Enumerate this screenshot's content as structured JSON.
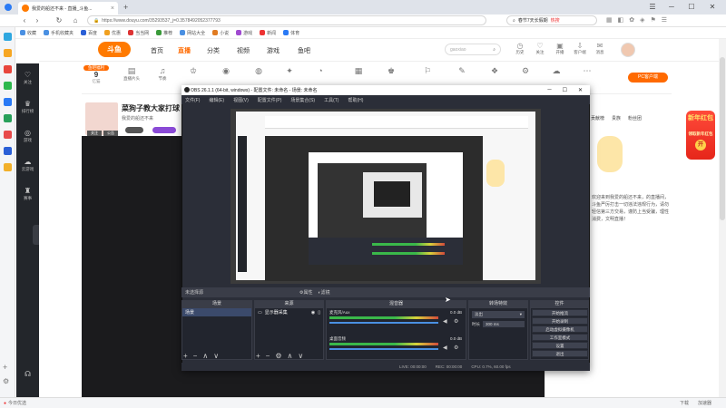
{
  "browser": {
    "tab_title": "我爱的船还不来 - 直播_斗鱼...",
    "url": "https://www.douyu.com/35293537_j=0.3578492052377793",
    "right_search": "春节7天长假期",
    "right_search_badge": "热搜"
  },
  "bookmarks": [
    "收藏",
    "手机收藏夹",
    "百度",
    "优惠",
    "当当网",
    "推荐",
    "网站大全",
    "小说",
    "游戏",
    "新闻",
    "体育",
    "公益",
    "网络",
    "视频"
  ],
  "header": {
    "logo": "斗鱼",
    "nav": [
      "首页",
      "直播",
      "分类",
      "视频",
      "游戏",
      "鱼吧"
    ],
    "search_placeholder": "gaoxiao",
    "right_icons": [
      {
        "label": "历史",
        "icon": "history-icon"
      },
      {
        "label": "关注",
        "icon": "follow-icon"
      },
      {
        "label": "开播",
        "icon": "broadcast-icon"
      },
      {
        "label": "客户端",
        "icon": "download-icon"
      },
      {
        "label": "消息",
        "icon": "message-icon"
      }
    ]
  },
  "room": {
    "rank_badge": "鱼吧福利",
    "rank_value": "9",
    "rank_label": "亿猫",
    "icons": [
      {
        "label": "直播片头",
        "icon": "intro-icon"
      },
      {
        "label": "节奏",
        "icon": "rhythm-icon"
      },
      {
        "label": "贵族",
        "icon": "noble-icon"
      },
      {
        "label": "任务",
        "icon": "task-icon"
      },
      {
        "label": "鱼丸",
        "icon": "ball-icon"
      },
      {
        "label": "抽奖",
        "icon": "lottery-icon"
      },
      {
        "label": "签到",
        "icon": "sign-icon"
      },
      {
        "label": "宝箱",
        "icon": "box-icon"
      },
      {
        "label": "云存储",
        "icon": "cloud-icon"
      },
      {
        "label": "粉丝",
        "icon": "fans-icon"
      },
      {
        "label": "分享",
        "icon": "share-icon"
      },
      {
        "label": "编辑",
        "icon": "edit-icon"
      },
      {
        "label": "礼物",
        "icon": "gift-icon"
      },
      {
        "label": "设置",
        "icon": "settings-icon"
      }
    ],
    "pc_button": "PC客户端",
    "title": "菜狗子教大家打球",
    "tags": [
      "关注",
      "公告"
    ],
    "streamer": "我爱的船还不来"
  },
  "sidebar": [
    "关注",
    "排行榜",
    "游戏",
    "云游戏",
    "赛事"
  ],
  "right_panel": {
    "tabs": [
      "贡献榜",
      "贵族",
      "粉丝团"
    ],
    "chat": "欢迎来到我爱的船还不来，的直播间，斗鱼严厉打击一切违法违规行为，请勿轻信第三方交易，谨防上当受骗，理性消费，文明直播！",
    "red_packet_title": "新年红包",
    "red_packet_sub": "领取新年红包",
    "red_packet_btn": "开"
  },
  "obs": {
    "title": "OBS 26.1.1 (64-bit, windows) - 配置文件: 未命名 - 场景: 未命名",
    "menu": [
      "文件(F)",
      "编辑(E)",
      "视图(V)",
      "配置文件(P)",
      "场景集合(S)",
      "工具(T)",
      "帮助(H)"
    ],
    "no_source": "未选择源",
    "props_btn": "属性",
    "filter_btn": "滤镜",
    "panels": [
      "场景",
      "来源",
      "混音器",
      "转场特效",
      "控件"
    ],
    "scene_item": "场景",
    "source_item": "显示器采集",
    "mixer": [
      {
        "name": "麦克风/Aux",
        "db": "0.0 dB"
      },
      {
        "name": "桌面音频",
        "db": "0.0 dB"
      }
    ],
    "transition": "淡出",
    "duration_label": "时长",
    "duration_value": "300 ms",
    "controls": [
      "开始推流",
      "开始录制",
      "启动虚拟摄像机",
      "工作室模式",
      "设置",
      "退出"
    ],
    "status": {
      "live": "LIVE: 00:00:00",
      "rec": "REC: 00:00:00",
      "cpu": "CPU: 0.7%, 60.00 fps"
    }
  },
  "bottom": {
    "left": "今日优选",
    "right": [
      "下载",
      "加速器"
    ]
  }
}
